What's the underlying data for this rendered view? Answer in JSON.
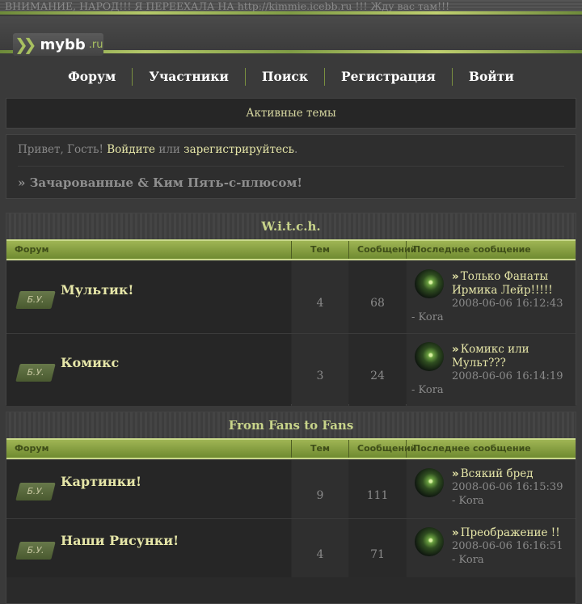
{
  "announcement": "ВНИМАНИЕ, НАРОД!!! Я ПЕРЕЕХАЛА НА http://kimmie.icebb.ru !!! Жду вас там!!!",
  "logo": {
    "text": "mybb",
    "tld": ".ru"
  },
  "nav": [
    "Форум",
    "Участники",
    "Поиск",
    "Регистрация",
    "Войти"
  ],
  "active_topics": "Активные темы",
  "welcome": {
    "greeting": "Привет, Гость!",
    "login": "Войдите",
    "or": "или",
    "register": "зарегистрируйтесь",
    "dot": "."
  },
  "board_title": "» Зачарованные & Ким Пять-с-плюсом!",
  "columns": {
    "forum": "Форум",
    "topics": "Тем",
    "posts": "Сообщений",
    "last": "Последнее сообщение"
  },
  "badge": "Б.У.",
  "categories": [
    {
      "title": "W.i.t.c.h.",
      "forums": [
        {
          "name": "Мультик!",
          "topics": "4",
          "posts": "68",
          "last_title": "Только Фанаты Ирмика Лейр!!!!!",
          "last_date": "2008-06-06 16:12:43",
          "last_author": "- Kora"
        },
        {
          "name": "Комикс",
          "topics": "3",
          "posts": "24",
          "last_title": "Комикс или Мульт???",
          "last_date": "2008-06-06 16:14:19",
          "last_author": "- Kora"
        }
      ]
    },
    {
      "title": "From Fans to Fans",
      "forums": [
        {
          "name": "Картинки!",
          "topics": "9",
          "posts": "111",
          "last_title": "Всякий бред",
          "last_date": "2008-06-06 16:15:39",
          "last_author": "- Kora"
        },
        {
          "name": "Наши Рисунки!",
          "topics": "4",
          "posts": "71",
          "last_title": "Преображение !!",
          "last_date": "2008-06-06 16:16:51",
          "last_author": "- Kora"
        }
      ]
    }
  ],
  "colors": {
    "accent": "#a8c060",
    "link": "#e6e6a8",
    "background": "#3a3a3a"
  },
  "icons": {
    "logo_chevrons": "double-chevron-icon",
    "last_post_arrow": "double-chevron-icon"
  }
}
